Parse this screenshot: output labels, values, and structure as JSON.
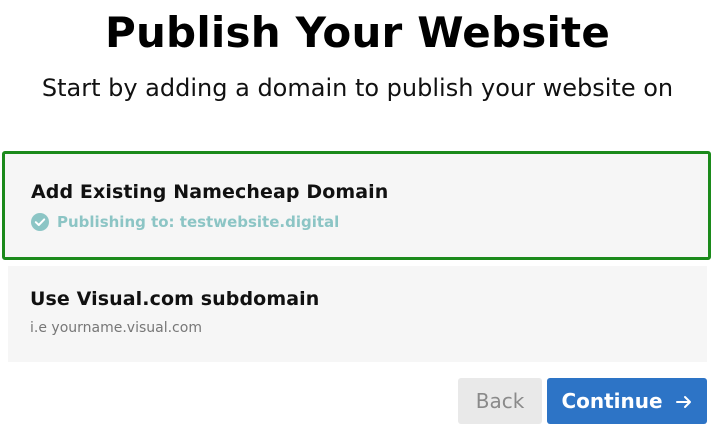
{
  "header": {
    "title": "Publish Your Website",
    "subtitle": "Start by adding a domain to publish your website on"
  },
  "options": [
    {
      "title": "Add Existing Namecheap Domain",
      "status": "Publishing to: testwebsite.digital",
      "selected": true,
      "icon": "check-circle-icon"
    },
    {
      "title": "Use Visual.com subdomain",
      "hint": "i.e yourname.visual.com",
      "selected": false
    }
  ],
  "footer": {
    "back_label": "Back",
    "continue_label": "Continue",
    "continue_icon": "arrow-right-icon"
  },
  "colors": {
    "selected_border": "#1b8a1b",
    "status_text": "#8cc5c5",
    "primary_button": "#2d74c6",
    "secondary_button": "#e9e9e9"
  }
}
